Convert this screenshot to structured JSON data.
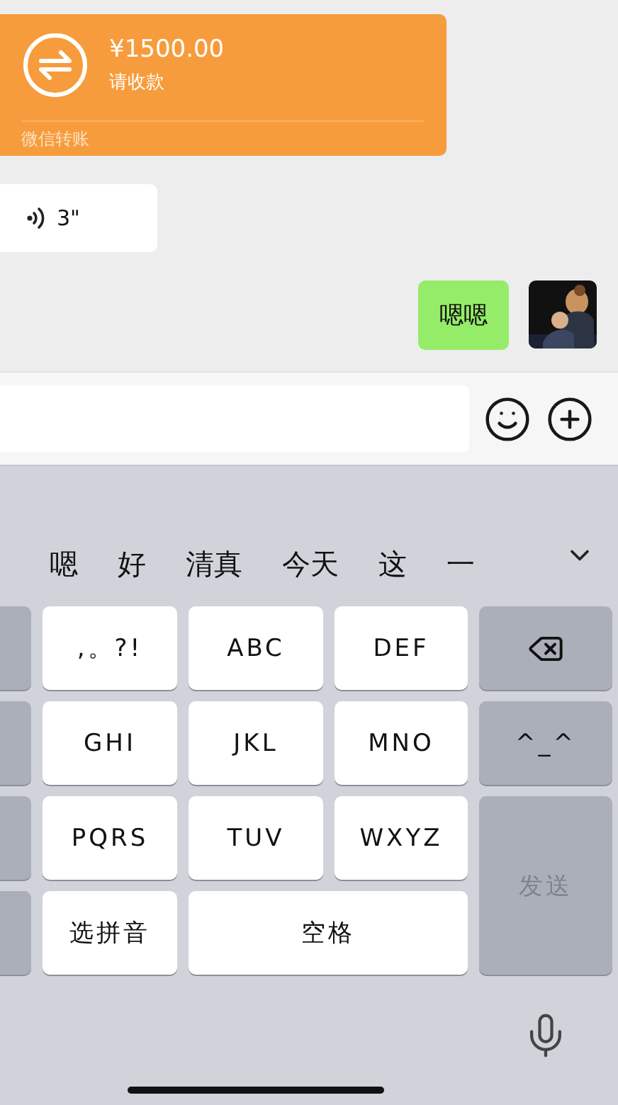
{
  "messages": [
    {
      "kind": "transfer",
      "amount": "¥1500.00",
      "note": "请收款",
      "footer": "微信转账"
    },
    {
      "kind": "voice",
      "duration": "3\""
    },
    {
      "kind": "text",
      "text": "嗯嗯"
    }
  ],
  "keyboard": {
    "candidates": [
      "嗯",
      "好",
      "清真",
      "今天",
      "这",
      "一"
    ],
    "keys": [
      {
        "kind": "side"
      },
      {
        "kind": "char",
        "label": ",。?!"
      },
      {
        "kind": "char",
        "label": "ABC"
      },
      {
        "kind": "char",
        "label": "DEF"
      },
      {
        "kind": "delete"
      },
      {
        "kind": "side"
      },
      {
        "kind": "char",
        "label": "GHI"
      },
      {
        "kind": "char",
        "label": "JKL"
      },
      {
        "kind": "char",
        "label": "MNO"
      },
      {
        "kind": "action",
        "label": "^_^"
      },
      {
        "kind": "side"
      },
      {
        "kind": "char",
        "label": "PQRS"
      },
      {
        "kind": "char",
        "label": "TUV"
      },
      {
        "kind": "char",
        "label": "WXYZ"
      },
      {
        "kind": "send",
        "label": "发送",
        "disabled": true
      },
      {
        "kind": "side"
      },
      {
        "kind": "char",
        "label": "选拼音"
      },
      {
        "kind": "space",
        "label": "空格"
      }
    ]
  }
}
